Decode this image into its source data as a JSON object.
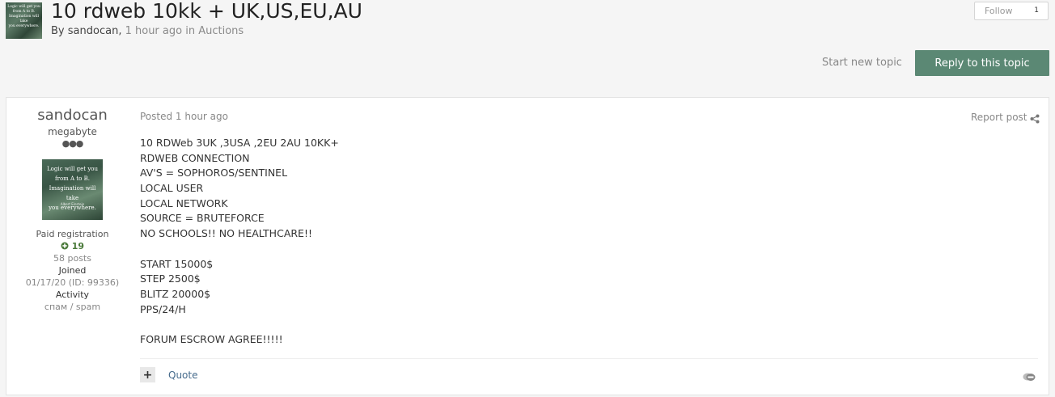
{
  "topic": {
    "title": "10 rdweb 10kk + UK,US,EU,AU",
    "by_prefix": "By",
    "author": "sandocan",
    "comma": ",",
    "time": "1 hour ago",
    "in_text": "in",
    "forum": "Auctions",
    "thumb_text": "Logic will get you\nfrom A to B.\nImagination will take\nyou everywhere."
  },
  "follow": {
    "label": "Follow",
    "count": "1"
  },
  "actions": {
    "start_new": "Start new topic",
    "reply": "Reply to this topic"
  },
  "post": {
    "author": {
      "name": "sandocan",
      "rank": "megabyte",
      "rank_dots": "●●●",
      "avatar_text": "Logic will get you\nfrom A to B.\nImagination will take\nyou everywhere.",
      "avatar_sig": "Albert Einstein",
      "group": "Paid registration",
      "reputation": "19",
      "posts": "58 posts",
      "joined_label": "Joined",
      "joined_value": "01/17/20 (ID: 99336)",
      "activity_label": "Activity",
      "activity_value": "спам / spam"
    },
    "posted": "Posted 1 hour ago",
    "report": "Report post",
    "lines": [
      "10 RDWeb 3UK ,3USA ,2EU 2AU 10KK+",
      "RDWEB CONNECTION",
      "AV'S = SOPHOROS/SENTINEL",
      "LOCAL USER",
      "LOCAL NETWORK",
      "SOURCE = BRUTEFORCE",
      "NO SCHOOLS!! NO HEALTHCARE!!",
      "",
      "START 15000$",
      "STEP 2500$",
      "BLITZ 20000$",
      "PPS/24/H",
      "",
      "FORUM ESCROW AGREE!!!!!"
    ],
    "quote": "Quote",
    "plus": "+"
  },
  "icons": {
    "share": "share-icon",
    "plus": "plus-icon",
    "reputation": "plus-circle-icon",
    "reaction": "reaction-icon"
  },
  "colors": {
    "accent": "#5b8874",
    "link": "#466b8c",
    "reputation": "#4a7a3a"
  }
}
